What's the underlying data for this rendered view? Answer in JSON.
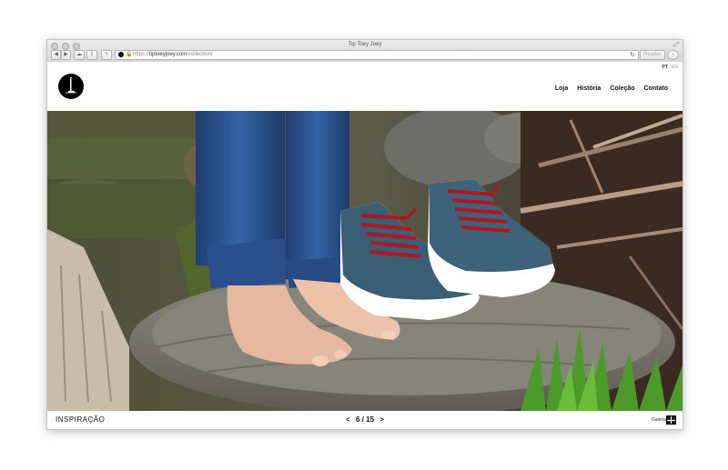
{
  "browser": {
    "window_title": "Tip Toey Joey",
    "url_protocol": "https://",
    "url_host": "tiptoeyjoey.com",
    "url_path": "/collection/",
    "reader_label": "Reader",
    "icons": [
      "back-icon",
      "forward-icon",
      "icloud-icon",
      "share-icon",
      "new-tab-icon",
      "reload-icon",
      "download-icon",
      "fullscreen-icon"
    ]
  },
  "site": {
    "lang": {
      "pt": "PT",
      "sep": "/",
      "en": "EN"
    },
    "nav": [
      "Loja",
      "História",
      "Coleção",
      "Contato"
    ]
  },
  "hero": {
    "palette": {
      "wood": "#5a5a3a",
      "moss": "#4b5e2b",
      "jeans": "#2d4f87",
      "shoe": "#3a5e74",
      "laces": "#b0161e",
      "stump": "#7d7a73",
      "grass": "#4c9a2a"
    }
  },
  "footer": {
    "section_title": "INSPIRAÇÃO",
    "prev": "<",
    "next": ">",
    "current": "6",
    "separator": "/",
    "total": "15",
    "gallery_label": "Galeria"
  }
}
